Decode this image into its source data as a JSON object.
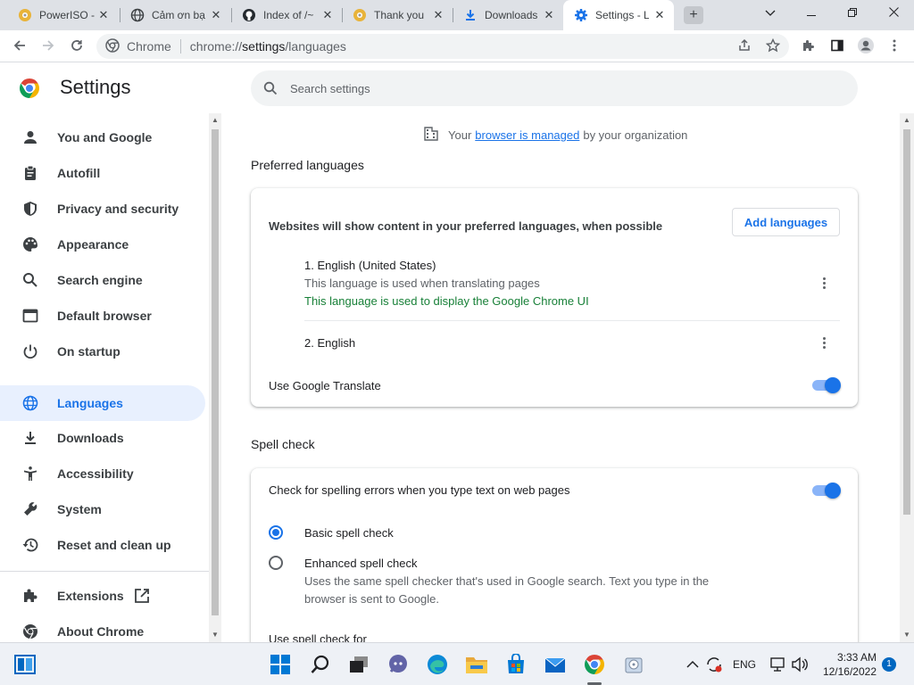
{
  "tabs": [
    {
      "label": "PowerISO -",
      "icon": "poweriso-icon"
    },
    {
      "label": "Cảm ơn bạ",
      "icon": "globe-icon"
    },
    {
      "label": "Index of /~",
      "icon": "github-icon"
    },
    {
      "label": "Thank you",
      "icon": "poweriso-icon"
    },
    {
      "label": "Downloads",
      "icon": "download-icon"
    },
    {
      "label": "Settings - L",
      "icon": "settings-gear-icon",
      "active": true
    }
  ],
  "omnibox": {
    "chip": "Chrome",
    "url_scheme": "chrome://",
    "url_host": "settings",
    "url_path": "/languages"
  },
  "header": {
    "title": "Settings",
    "search_placeholder": "Search settings"
  },
  "sidebar": {
    "items": [
      {
        "label": "You and Google",
        "icon": "person-icon"
      },
      {
        "label": "Autofill",
        "icon": "clipboard-icon"
      },
      {
        "label": "Privacy and security",
        "icon": "shield-icon"
      },
      {
        "label": "Appearance",
        "icon": "palette-icon"
      },
      {
        "label": "Search engine",
        "icon": "search-icon"
      },
      {
        "label": "Default browser",
        "icon": "browser-icon"
      },
      {
        "label": "On startup",
        "icon": "power-icon"
      },
      {
        "label": "Languages",
        "icon": "globe-icon",
        "selected": true
      },
      {
        "label": "Downloads",
        "icon": "download-icon"
      },
      {
        "label": "Accessibility",
        "icon": "accessibility-icon"
      },
      {
        "label": "System",
        "icon": "wrench-icon"
      },
      {
        "label": "Reset and clean up",
        "icon": "history-icon"
      },
      {
        "label": "Extensions",
        "icon": "puzzle-icon"
      },
      {
        "label": "About Chrome",
        "icon": "chrome-icon"
      }
    ]
  },
  "managed": {
    "prefix": "Your",
    "link": "browser is managed",
    "suffix": "by your organization"
  },
  "preferred": {
    "title": "Preferred languages",
    "description": "Websites will show content in your preferred languages, when possible",
    "add_button": "Add languages",
    "languages": [
      {
        "name": "1. English (United States)",
        "note1": "This language is used when translating pages",
        "note2": "This language is used to display the Google Chrome UI"
      },
      {
        "name": "2. English"
      }
    ],
    "translate_label": "Use Google Translate",
    "translate_on": true
  },
  "spell": {
    "title": "Spell check",
    "check_label": "Check for spelling errors when you type text on web pages",
    "check_on": true,
    "basic_label": "Basic spell check",
    "enhanced_label": "Enhanced spell check",
    "enhanced_desc1": "Uses the same spell checker that's used in Google search. Text you type in the",
    "enhanced_desc2": "browser is sent to Google.",
    "use_for_label": "Use spell check for"
  },
  "taskbar": {
    "lang": "ENG",
    "time": "3:33 AM",
    "date": "12/16/2022",
    "notifications": "1"
  },
  "colors": {
    "accent": "#1a73e8",
    "green": "#188038",
    "selected_bg": "#e8f0fe"
  }
}
